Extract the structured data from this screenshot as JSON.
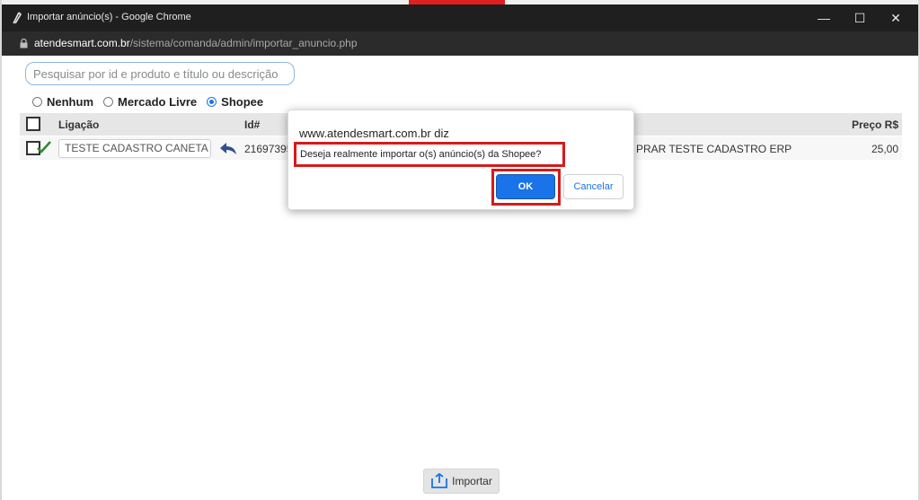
{
  "window": {
    "title": "Importar anúncio(s) - Google Chrome",
    "controls": {
      "minimize": "—",
      "maximize": "☐",
      "close": "✕"
    }
  },
  "urlbar": {
    "host": "atendesmart.com.br",
    "path": "/sistema/comanda/admin/importar_anuncio.php"
  },
  "search": {
    "placeholder": "Pesquisar por id e produto e título ou descrição",
    "value": ""
  },
  "filters": {
    "options": [
      {
        "label": "Nenhum",
        "checked": false
      },
      {
        "label": "Mercado Livre",
        "checked": false
      },
      {
        "label": "Shopee",
        "checked": true
      }
    ]
  },
  "table": {
    "headers": {
      "link": "Ligação",
      "id": "Id#",
      "price": "Preço R$"
    },
    "rows": [
      {
        "checked": true,
        "link_value": "TESTE CADASTRO CANETA",
        "id": "21697395",
        "title": "PRAR TESTE CADASTRO ERP",
        "price": "25,00"
      }
    ]
  },
  "dialog": {
    "origin": "www.atendesmart.com.br diz",
    "message": "Deseja realmente importar o(s) anúncio(s) da Shopee?",
    "ok_label": "OK",
    "cancel_label": "Cancelar"
  },
  "footer": {
    "import_label": "Importar"
  },
  "colors": {
    "accent": "#1a73e8",
    "highlight": "#d51b1b",
    "titlebar": "#1f1f1f",
    "check": "#2e8b2e"
  },
  "icons": {
    "window": "chrome-window-icon",
    "lock": "lock-icon",
    "link": "reply-arrow-icon",
    "import": "import-arrow-icon"
  }
}
